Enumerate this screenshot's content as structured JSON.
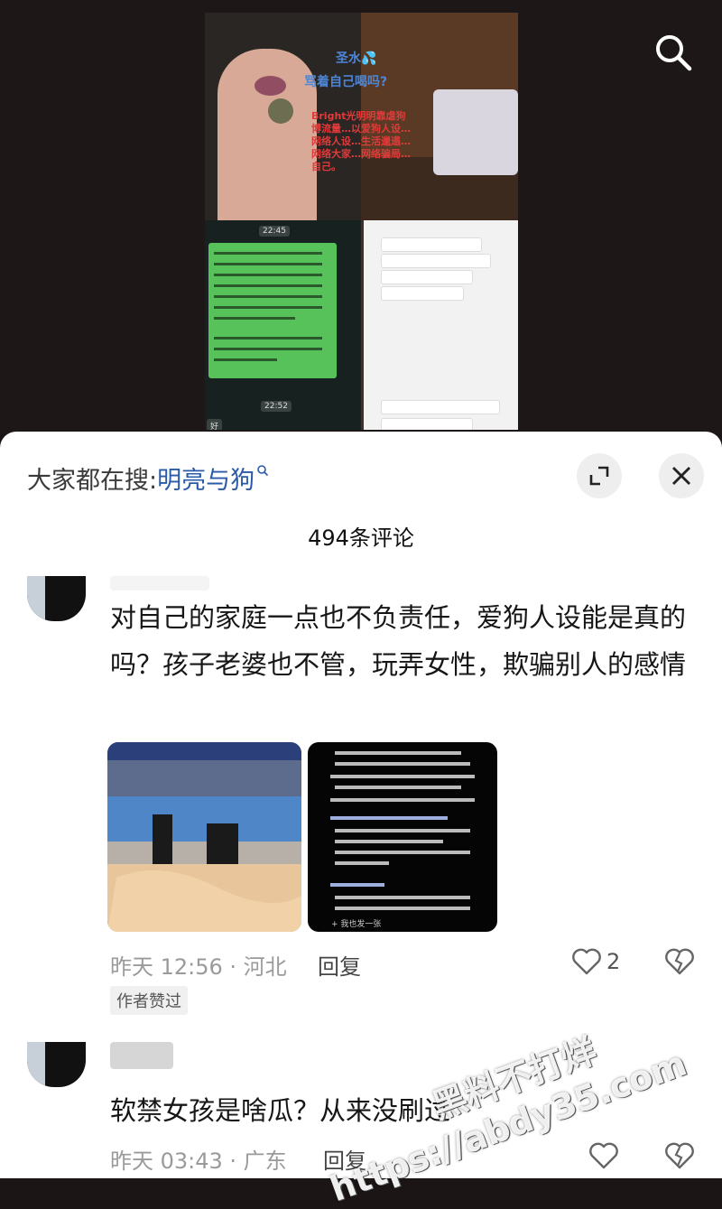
{
  "video": {
    "overlay_title": "圣水💦",
    "overlay_question": "骂着自己喝吗?",
    "overlay_red": "Bright光明明靠虐狗博流量…以爱狗人设…网络人设…生活邋遢…网络大家…网络骗局…自己。",
    "time_top": "22:45",
    "time_bottom": "22:52",
    "chip": "好"
  },
  "search": {
    "prefix": "大家都在搜:",
    "term": "明亮与狗"
  },
  "comments_count": "494条评论",
  "comments": [
    {
      "text": "对自己的家庭一点也不负责任，爱狗人设能是真的吗？孩子老婆也不管，玩弄女性，欺骗别人的感情",
      "time_location": "昨天 12:56 · 河北",
      "reply_label": "回复",
      "likes": "2",
      "author_liked": "作者赞过",
      "image2_caption": "+ 我也发一张"
    },
    {
      "text": "软禁女孩是啥瓜？从来没刷过",
      "time_location": "昨天 03:43 · 广东",
      "reply_label": "回复"
    }
  ],
  "watermark": {
    "line1": "黑料不打烊",
    "line2": "https://abdy35.com"
  },
  "colors": {
    "sheet_bg": "#ffffff",
    "search_term": "#2b5aa8",
    "video_bg": "#1d1817"
  },
  "icons": [
    "search-icon",
    "search-term-icon",
    "expand-icon",
    "close-icon",
    "heart-icon",
    "broken-heart-icon"
  ]
}
